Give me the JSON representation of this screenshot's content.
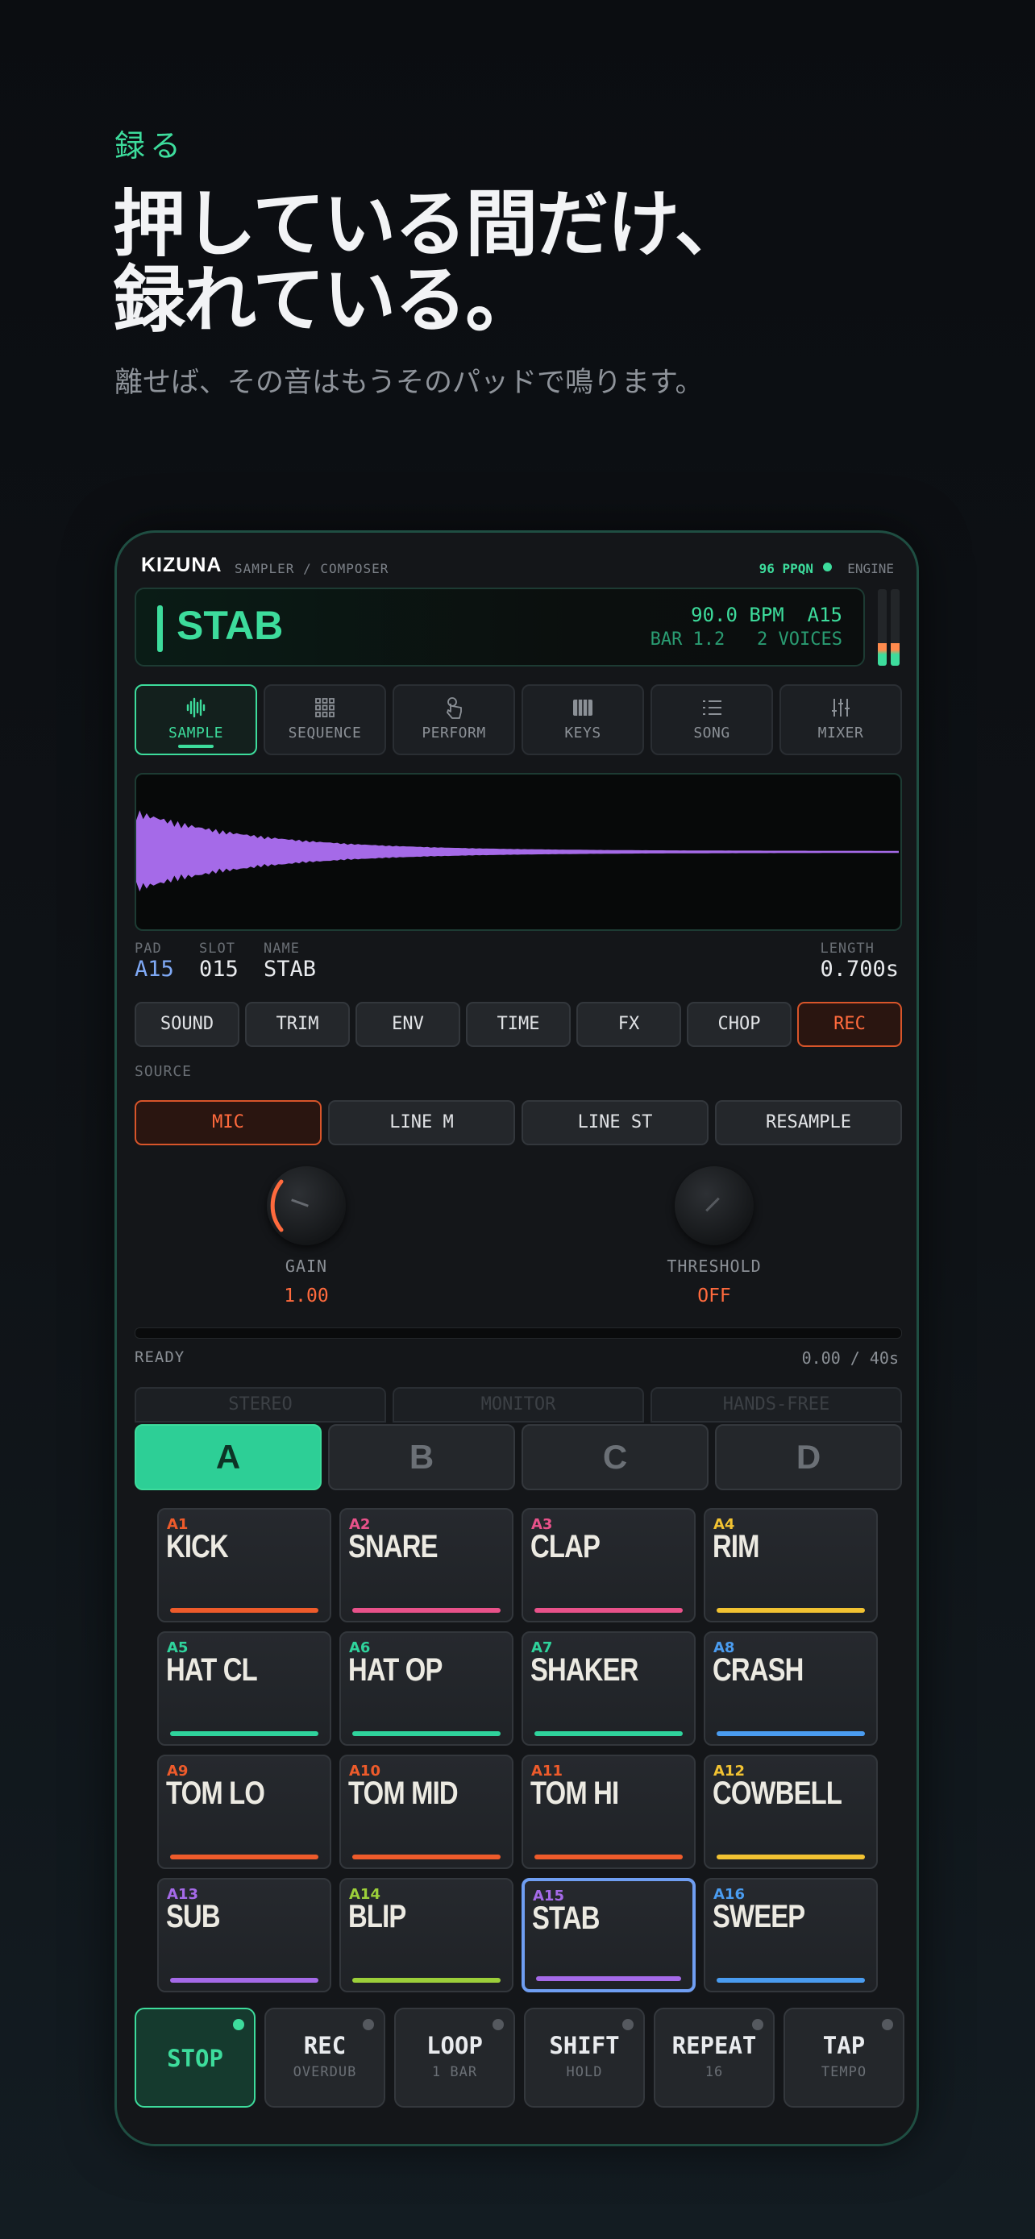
{
  "promo": {
    "eyebrow": "録る",
    "headline_1": "押している間だけ、",
    "headline_2": "録れている。",
    "subhead": "離せば、その音はもうそのパッドで鳴ります。"
  },
  "app": {
    "brand": "KIZUNA",
    "subtitle": "SAMPLER / COMPOSER",
    "ppqn": "96 PPQN",
    "engine": "ENGINE"
  },
  "lcd": {
    "name": "STAB",
    "bpm_pad": "90.0 BPM  A15",
    "bar_voices": "BAR 1.2   2 VOICES",
    "meter_left": 0.3,
    "meter_right": 0.3
  },
  "tabs": [
    {
      "label": "SAMPLE",
      "icon": "waveform-icon"
    },
    {
      "label": "SEQUENCE",
      "icon": "grid-icon"
    },
    {
      "label": "PERFORM",
      "icon": "hand-icon"
    },
    {
      "label": "KEYS",
      "icon": "piano-icon"
    },
    {
      "label": "SONG",
      "icon": "list-icon"
    },
    {
      "label": "MIXER",
      "icon": "sliders-icon"
    }
  ],
  "sample": {
    "pad_label": "PAD",
    "pad": "A15",
    "slot_label": "SLOT",
    "slot": "015",
    "name_label": "NAME",
    "name": "STAB",
    "length_label": "LENGTH",
    "length": "0.700s"
  },
  "subtabs": [
    "SOUND",
    "TRIM",
    "ENV",
    "TIME",
    "FX",
    "CHOP",
    "REC"
  ],
  "source": {
    "label": "SOURCE",
    "options": [
      "MIC",
      "LINE M",
      "LINE ST",
      "RESAMPLE"
    ],
    "selected": "MIC"
  },
  "knobs": {
    "gain_label": "GAIN",
    "gain": "1.00",
    "threshold_label": "THRESHOLD",
    "threshold": "OFF"
  },
  "status": {
    "state": "READY",
    "time": "0.00 / 40s"
  },
  "hidden_row": [
    "STEREO",
    "MONITOR",
    "HANDS-FREE"
  ],
  "banks": [
    "A",
    "B",
    "C",
    "D"
  ],
  "pads": [
    {
      "id": "A1",
      "name": "KICK",
      "color": "#ee5b2b"
    },
    {
      "id": "A2",
      "name": "SNARE",
      "color": "#e8528a"
    },
    {
      "id": "A3",
      "name": "CLAP",
      "color": "#e8528a"
    },
    {
      "id": "A4",
      "name": "RIM",
      "color": "#f1c232"
    },
    {
      "id": "A5",
      "name": "HAT CL",
      "color": "#2fd39c"
    },
    {
      "id": "A6",
      "name": "HAT OP",
      "color": "#2fd39c"
    },
    {
      "id": "A7",
      "name": "SHAKER",
      "color": "#2fd39c"
    },
    {
      "id": "A8",
      "name": "CRASH",
      "color": "#4a9cf0"
    },
    {
      "id": "A9",
      "name": "TOM LO",
      "color": "#ee5b2b"
    },
    {
      "id": "A10",
      "name": "TOM MID",
      "color": "#ee5b2b"
    },
    {
      "id": "A11",
      "name": "TOM HI",
      "color": "#ee5b2b"
    },
    {
      "id": "A12",
      "name": "COWBELL",
      "color": "#f1c232"
    },
    {
      "id": "A13",
      "name": "SUB",
      "color": "#a56ae8"
    },
    {
      "id": "A14",
      "name": "BLIP",
      "color": "#9ccf3a"
    },
    {
      "id": "A15",
      "name": "STAB",
      "color": "#a56ae8"
    },
    {
      "id": "A16",
      "name": "SWEEP",
      "color": "#4a9cf0"
    }
  ],
  "selected_pad": "A15",
  "transport": [
    {
      "label": "STOP",
      "sub": ""
    },
    {
      "label": "REC",
      "sub": "OVERDUB"
    },
    {
      "label": "LOOP",
      "sub": "1 BAR"
    },
    {
      "label": "SHIFT",
      "sub": "HOLD"
    },
    {
      "label": "REPEAT",
      "sub": "16"
    },
    {
      "label": "TAP",
      "sub": "TEMPO"
    }
  ],
  "colors": {
    "accent": "#3ddc9c",
    "rec": "#ff6a3d",
    "selection": "#6f9ef2",
    "waveform": "#a56ae8"
  }
}
